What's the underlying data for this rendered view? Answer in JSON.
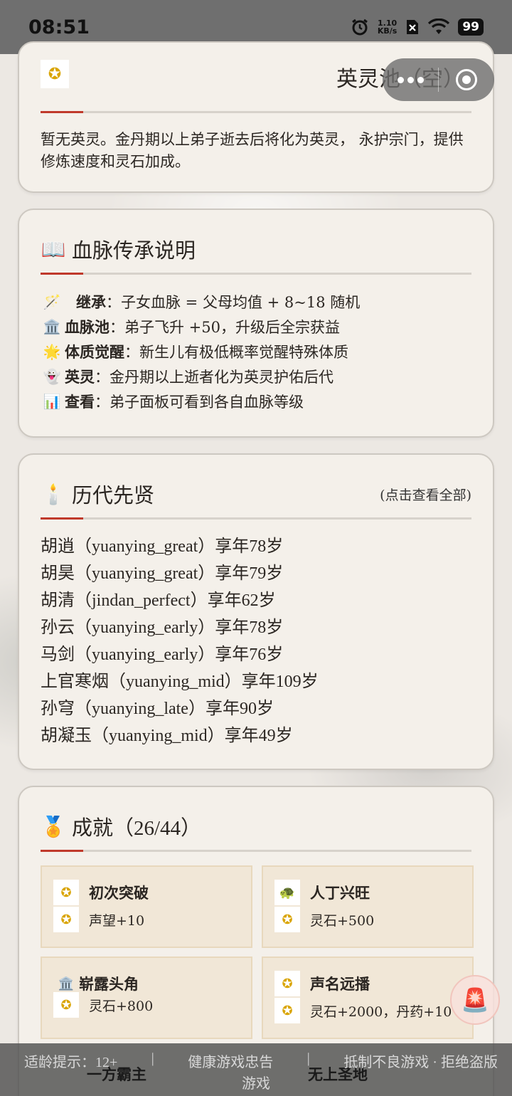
{
  "status_bar": {
    "time": "08:51",
    "net_speed_value": "1.10",
    "net_speed_unit": "KB/s",
    "battery": "99"
  },
  "hero_pool": {
    "title": "英灵池（空）",
    "description": "暂无英灵。金丹期以上弟子逝去后将化为英灵， 永护宗门，提供修炼速度和灵石加成。"
  },
  "bloodline": {
    "title": "血脉传承说明",
    "title_icon": "📖",
    "items": [
      {
        "icon": "🪄",
        "key": "继承",
        "text": "：子女血脉 = 父母均值 + 8~18 随机"
      },
      {
        "icon": "🏛️",
        "key": "血脉池",
        "text": "：弟子飞升 +50，升级后全宗获益"
      },
      {
        "icon": "🌟",
        "key": "体质觉醒",
        "text": "：新生儿有极低概率觉醒特殊体质"
      },
      {
        "icon": "👻",
        "key": "英灵",
        "text": "：金丹期以上逝者化为英灵护佑后代"
      },
      {
        "icon": "📊",
        "key": "查看",
        "text": "：弟子面板可看到各自血脉等级"
      }
    ]
  },
  "sages": {
    "title": "历代先贤",
    "title_icon": "🕯️",
    "link_hint": "(点击查看全部)",
    "list": [
      "胡逍（yuanying_great）享年78岁",
      "胡昊（yuanying_great）享年79岁",
      "胡清（jindan_perfect）享年62岁",
      "孙云（yuanying_early）享年78岁",
      "马剑（yuanying_early）享年76岁",
      "上官寒烟（yuanying_mid）享年109岁",
      "孙穹（yuanying_late）享年90岁",
      "胡凝玉（yuanying_mid）享年49岁"
    ]
  },
  "achievements": {
    "title": "成就（26/44）",
    "title_icon": "🏅",
    "items": [
      {
        "name": "初次突破",
        "icon": "✪",
        "reward": "声望+10"
      },
      {
        "name": "人丁兴旺",
        "icon": "🐢",
        "reward": "灵石+500"
      },
      {
        "name": "崭露头角",
        "icon": "🏛️",
        "reward": "灵石+800"
      },
      {
        "name": "声名远播",
        "icon": "✪",
        "reward": "灵石+2000，丹药+10"
      }
    ],
    "peek": [
      "一方霸主",
      "无上圣地"
    ]
  },
  "footer": {
    "age_hint": "适龄提示：12+",
    "sep": "|",
    "health": "健康游戏忠告",
    "slogan": "抵制不良游戏 · 拒绝盗版",
    "line2": "游戏"
  },
  "alarm_icon": "🚨"
}
